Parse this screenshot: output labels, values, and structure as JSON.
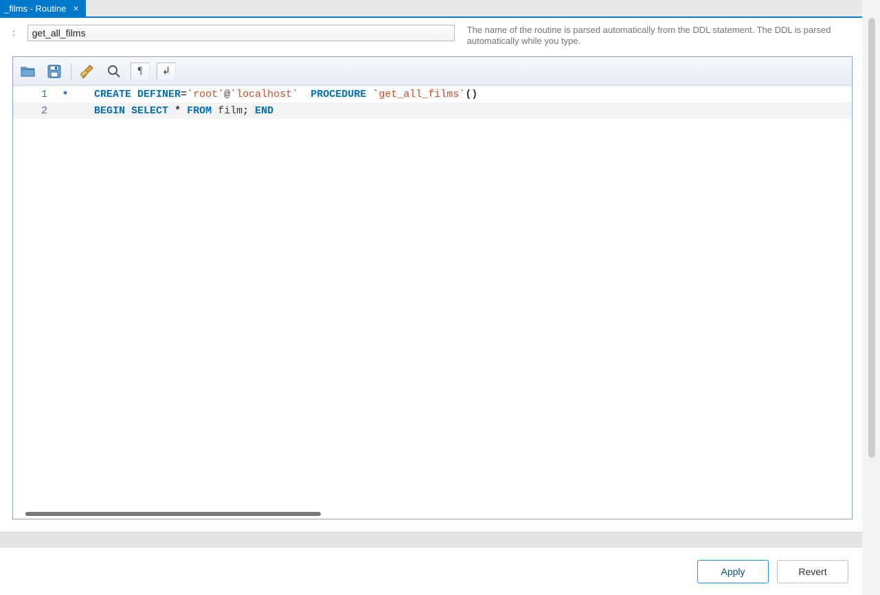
{
  "tab": {
    "label": "_films - Routine",
    "close_glyph": "×"
  },
  "name_field": {
    "value": "get_all_films"
  },
  "hint": {
    "text": "The name of the routine is parsed automatically from the DDL statement. The DDL is parsed automatically while you type."
  },
  "toolbar": {
    "open_icon": "open-file-icon",
    "save_icon": "save-icon",
    "beautify_icon": "broom-icon",
    "find_icon": "magnifier-icon",
    "invisibles_label": "¶",
    "wrap_label": "↲"
  },
  "code": {
    "lines": [
      {
        "n": "1",
        "marker": "•",
        "tokens": {
          "create": "CREATE",
          "definer": "DEFINER",
          "eq": "=",
          "bt1": "`",
          "root": "root",
          "bt2": "`",
          "at": "@",
          "bt3": "`",
          "localhost": "localhost",
          "bt4": "`",
          "sp1": "  ",
          "procedure": "PROCEDURE",
          "sp2": " ",
          "bt5": "`",
          "procname": "get_all_films",
          "bt6": "`",
          "paren": "()"
        }
      },
      {
        "n": "2",
        "marker": "",
        "tokens": {
          "begin": "BEGIN",
          "select": "SELECT",
          "star": "*",
          "from": "FROM",
          "table": "film",
          "semi": ";",
          "end": "END"
        }
      }
    ]
  },
  "footer": {
    "apply": "Apply",
    "revert": "Revert"
  }
}
